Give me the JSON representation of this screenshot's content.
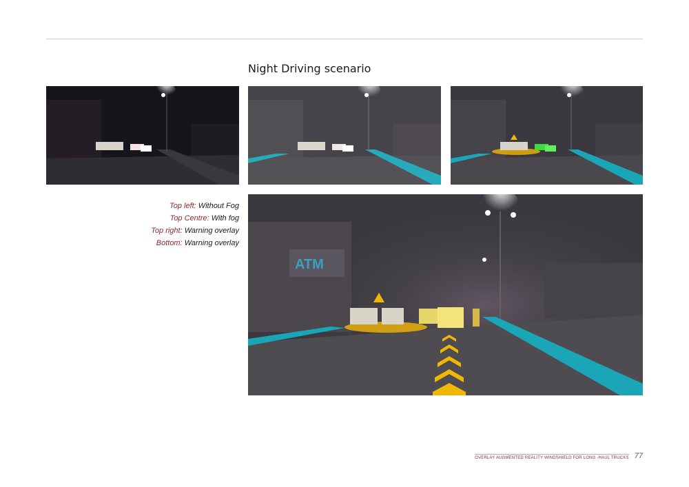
{
  "heading": "Night Driving scenario",
  "images": {
    "top_left": "night-street-without-fog",
    "top_centre": "night-street-with-fog",
    "top_right": "night-street-warning-overlay",
    "bottom": "night-street-warning-overlay-large",
    "sign_text": "ATM"
  },
  "captions": [
    {
      "key": "Top left:",
      "value": " Without Fog"
    },
    {
      "key": "Top Centre:",
      "value": " With fog"
    },
    {
      "key": "Top right:",
      "value": " Warning overlay"
    },
    {
      "key": "Bottom:",
      "value": " Warning overlay"
    }
  ],
  "footer": {
    "title": "OVERLAY AUGMENTED REALITY WINDSHIELD FOR LONG -HAUL TRUCKS",
    "page_number": "77"
  },
  "colors": {
    "caption_key": "#8b2a2a",
    "lane_overlay": "#1aa6b7",
    "warning_overlay": "#f2b705",
    "vehicle_highlight": "#3ddc3d"
  }
}
